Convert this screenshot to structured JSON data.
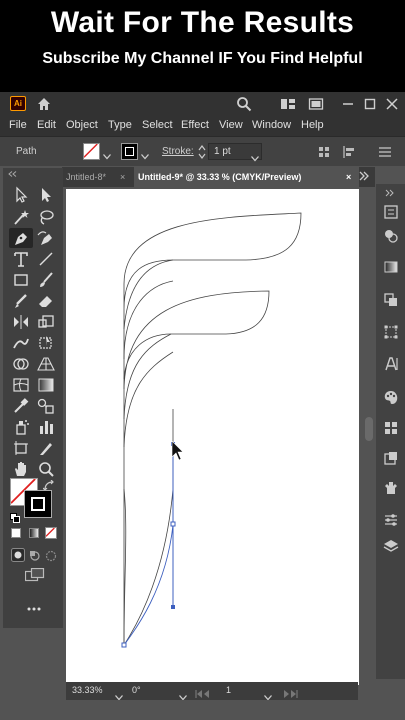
{
  "banner": {
    "title": "Wait For The Results",
    "subtitle": "Subscribe My Channel IF You Find Helpful"
  },
  "app": {
    "logo": "Ai",
    "menu": [
      "File",
      "Edit",
      "Object",
      "Type",
      "Select",
      "Effect",
      "View",
      "Window",
      "Help"
    ],
    "control": {
      "selection_label": "Path",
      "stroke_label": "Stroke:",
      "stroke_value": "1 pt"
    },
    "tabs": {
      "inactive": "Jntitled-8*",
      "active": "Untitled-9* @ 33.33 % (CMYK/Preview)",
      "close_glyph": "×"
    },
    "status": {
      "zoom": "33.33%",
      "rotation": "0°",
      "artboard": "1"
    },
    "colors": {
      "banner_bg": "#000000",
      "ui_bg": "#535353",
      "panel_bg": "#424242",
      "path_stroke": "#3d5fbf",
      "logo_orange": "#ff9a00"
    },
    "icons": [
      "home-icon",
      "search-icon",
      "arrange-documents-icon",
      "panel-icon",
      "minimize-icon",
      "maximize-icon",
      "close-icon"
    ]
  }
}
